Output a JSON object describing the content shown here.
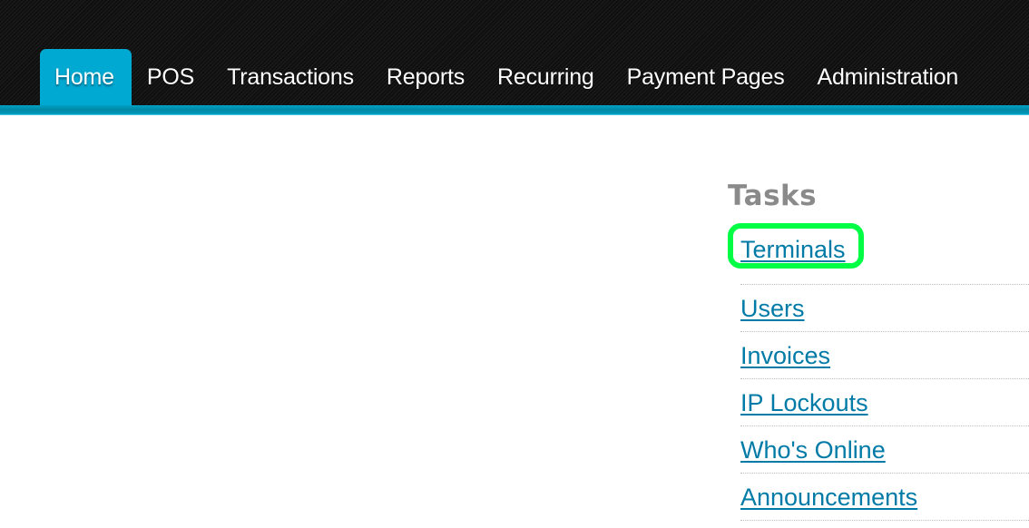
{
  "nav": {
    "items": [
      {
        "label": "Home",
        "active": true
      },
      {
        "label": "POS",
        "active": false
      },
      {
        "label": "Transactions",
        "active": false
      },
      {
        "label": "Reports",
        "active": false
      },
      {
        "label": "Recurring",
        "active": false
      },
      {
        "label": "Payment Pages",
        "active": false
      },
      {
        "label": "Administration",
        "active": false
      }
    ],
    "accent_color": "#00a9d1"
  },
  "tasks": {
    "title": "Tasks",
    "items": [
      {
        "label": "Terminals",
        "highlighted": true
      },
      {
        "label": "Users"
      },
      {
        "label": "Invoices"
      },
      {
        "label": "IP Lockouts"
      },
      {
        "label": "Who's Online"
      },
      {
        "label": "Announcements"
      }
    ],
    "link_color": "#007aa6",
    "highlight_color": "#00ff44"
  }
}
